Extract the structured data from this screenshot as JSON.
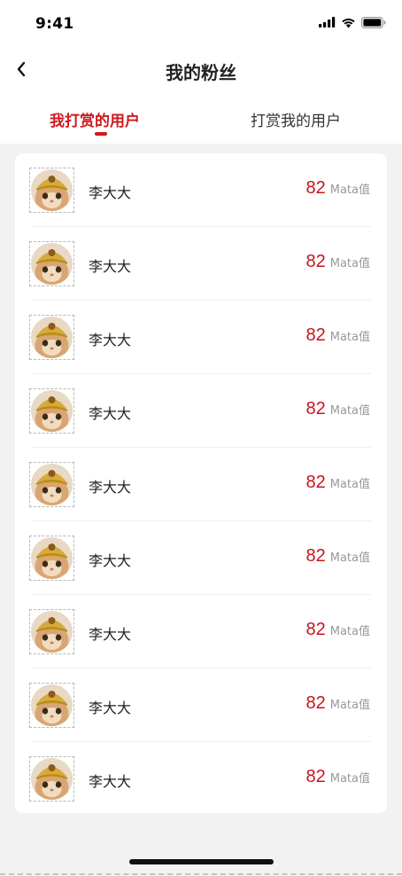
{
  "status_bar": {
    "time": "9:41",
    "signal_icon": "signal-icon",
    "wifi_icon": "wifi-icon",
    "battery_icon": "battery-icon"
  },
  "nav": {
    "title": "我的粉丝",
    "back_icon": "chevron-left-icon"
  },
  "tabs": [
    {
      "label": "我打赏的用户",
      "active": true
    },
    {
      "label": "打赏我的用户",
      "active": false
    }
  ],
  "colors": {
    "accent": "#d0191d",
    "points": "#c8141c",
    "background": "#f2f2f2"
  },
  "fans": [
    {
      "name": "李大大",
      "points": "82",
      "unit": "Mata值"
    },
    {
      "name": "李大大",
      "points": "82",
      "unit": "Mata值"
    },
    {
      "name": "李大大",
      "points": "82",
      "unit": "Mata值"
    },
    {
      "name": "李大大",
      "points": "82",
      "unit": "Mata值"
    },
    {
      "name": "李大大",
      "points": "82",
      "unit": "Mata值"
    },
    {
      "name": "李大大",
      "points": "82",
      "unit": "Mata值"
    },
    {
      "name": "李大大",
      "points": "82",
      "unit": "Mata值"
    },
    {
      "name": "李大大",
      "points": "82",
      "unit": "Mata值"
    },
    {
      "name": "李大大",
      "points": "82",
      "unit": "Mata值"
    }
  ]
}
